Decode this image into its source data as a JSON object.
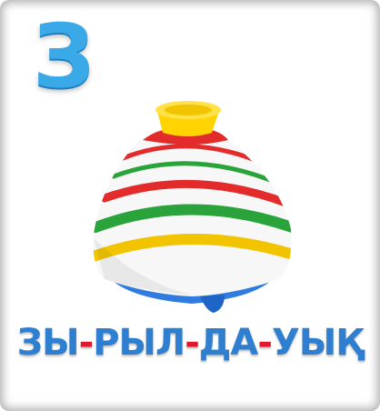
{
  "card": {
    "letter": "З",
    "word_parts": [
      "ЗЫ",
      "-",
      "РЫЛ",
      "-",
      "ДА",
      "-",
      "УЫҚ"
    ],
    "colors": {
      "letter": "#3aa9e8",
      "syllable": "#2f7fd1",
      "hyphen": "#e0182d"
    },
    "image_icon": "spinning-top-toy"
  }
}
